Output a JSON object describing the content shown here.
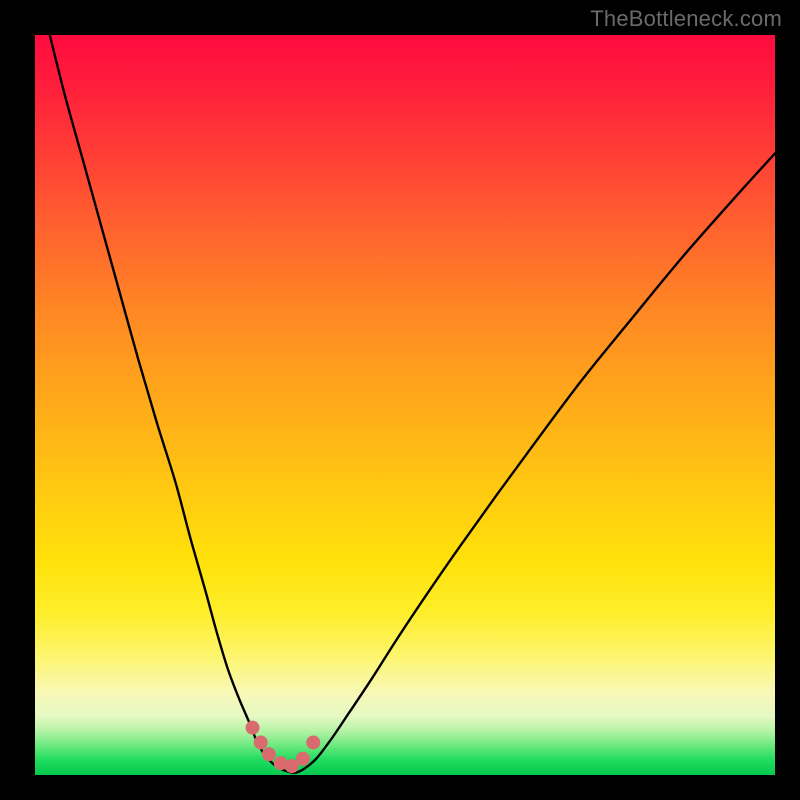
{
  "watermark": "TheBottleneck.com",
  "colors": {
    "background": "#000000",
    "curve_stroke": "#000000",
    "marker_fill": "#d96b6f",
    "marker_stroke": "#c75a5e"
  },
  "chart_data": {
    "type": "line",
    "title": "",
    "xlabel": "",
    "ylabel": "",
    "xlim": [
      0,
      100
    ],
    "ylim": [
      0,
      100
    ],
    "grid": false,
    "legend": false,
    "series": [
      {
        "name": "bottleneck-curve",
        "x": [
          2,
          4,
          6.5,
          9,
          11.5,
          14,
          16.5,
          19,
          21,
          23,
          24.5,
          26,
          27.5,
          29,
          30,
          31,
          32.2,
          33.5,
          35,
          36.3,
          38,
          40,
          42.5,
          45.5,
          49,
          53,
          57.5,
          62.5,
          68,
          74,
          80.5,
          87.5,
          95,
          100
        ],
        "y": [
          100,
          92,
          83,
          74,
          65,
          56,
          47.5,
          39.5,
          32,
          25,
          19.5,
          14.5,
          10.5,
          7,
          4.5,
          2.8,
          1.5,
          0.7,
          0.3,
          0.8,
          2.2,
          4.8,
          8.5,
          13,
          18.5,
          24.5,
          31,
          38,
          45.5,
          53.5,
          61.5,
          70,
          78.5,
          84
        ]
      }
    ],
    "markers": [
      {
        "x": 29.4,
        "y": 6.4
      },
      {
        "x": 30.5,
        "y": 4.4
      },
      {
        "x": 31.6,
        "y": 2.8
      },
      {
        "x": 33.2,
        "y": 1.6
      },
      {
        "x": 34.7,
        "y": 1.2
      },
      {
        "x": 36.2,
        "y": 2.2
      },
      {
        "x": 37.6,
        "y": 4.4
      }
    ]
  }
}
